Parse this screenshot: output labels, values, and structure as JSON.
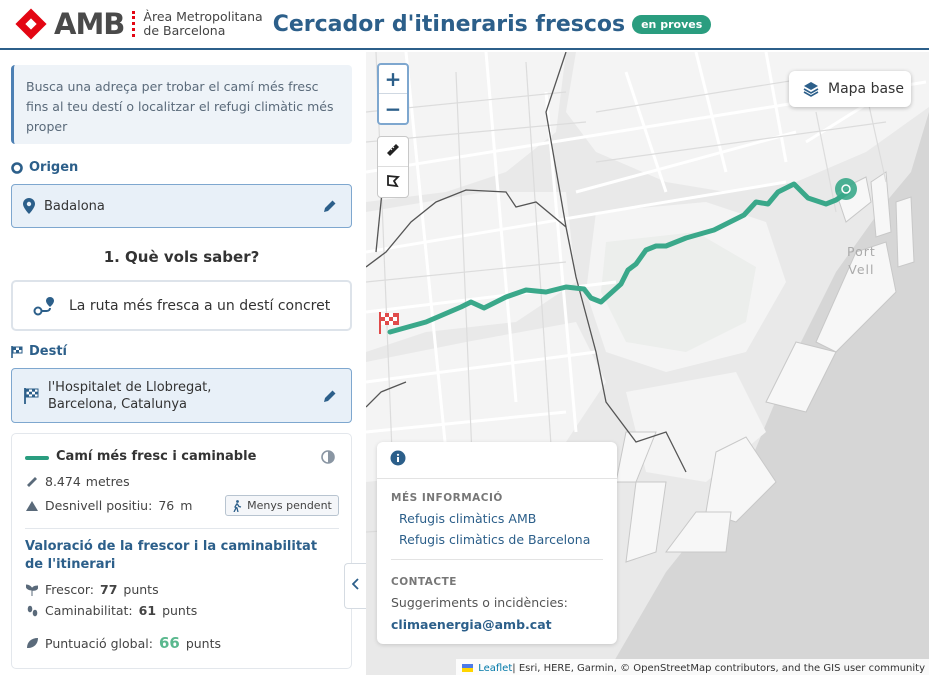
{
  "header": {
    "logo_text": "AMB",
    "logo_sub_1": "Àrea Metropolitana",
    "logo_sub_2": "de Barcelona",
    "title": "Cercador d'itineraris frescos",
    "badge": "en proves"
  },
  "sidebar": {
    "intro": "Busca una adreça per trobar el camí més fresc fins al teu destí o localitzar el refugi climàtic més proper",
    "origin_label": "Origen",
    "origin_value": "Badalona",
    "question": "1. Què vols saber?",
    "option_label": "La ruta més fresca a un destí concret",
    "destination_label": "Destí",
    "destination_value": "l'Hospitalet de Llobregat, Barcelona, Catalunya",
    "result": {
      "title": "Camí més fresc i caminable",
      "distance_value": "8.474",
      "distance_unit": "metres",
      "elevation_label": "Desnivell positiu:",
      "elevation_value": "76",
      "elevation_unit": "m",
      "less_slope_button": "Menys pendent",
      "rating_title": "Valoració de la frescor i la caminabilitat de l'itinerari",
      "freshness_label": "Frescor:",
      "freshness_value": "77",
      "freshness_unit": "punts",
      "walkability_label": "Caminabilitat:",
      "walkability_value": "61",
      "walkability_unit": "punts",
      "global_label": "Puntuació global:",
      "global_value": "66",
      "global_unit": "punts"
    }
  },
  "map": {
    "basemap_label": "Mapa base",
    "zoom_in": "+",
    "zoom_out": "−",
    "port_label_1": "Port",
    "port_label_2": "Vell",
    "info_panel": {
      "more_info_heading": "MÉS INFORMACIÓ",
      "link_1": "Refugis climàtics AMB",
      "link_2": "Refugis climàtics de Barcelona",
      "contact_heading": "CONTACTE",
      "contact_text": "Suggeriments o incidències:",
      "contact_email": "climaenergia@amb.cat"
    },
    "attribution_leaflet": "Leaflet",
    "attribution_rest": " | Esri, HERE, Garmin, © OpenStreetMap contributors, and the GIS user community"
  },
  "colors": {
    "primary": "#2c5f8a",
    "accent_green": "#2a9d7f",
    "route": "#3aa88a",
    "brand_red": "#e30613",
    "score_green": "#5ab88e"
  }
}
